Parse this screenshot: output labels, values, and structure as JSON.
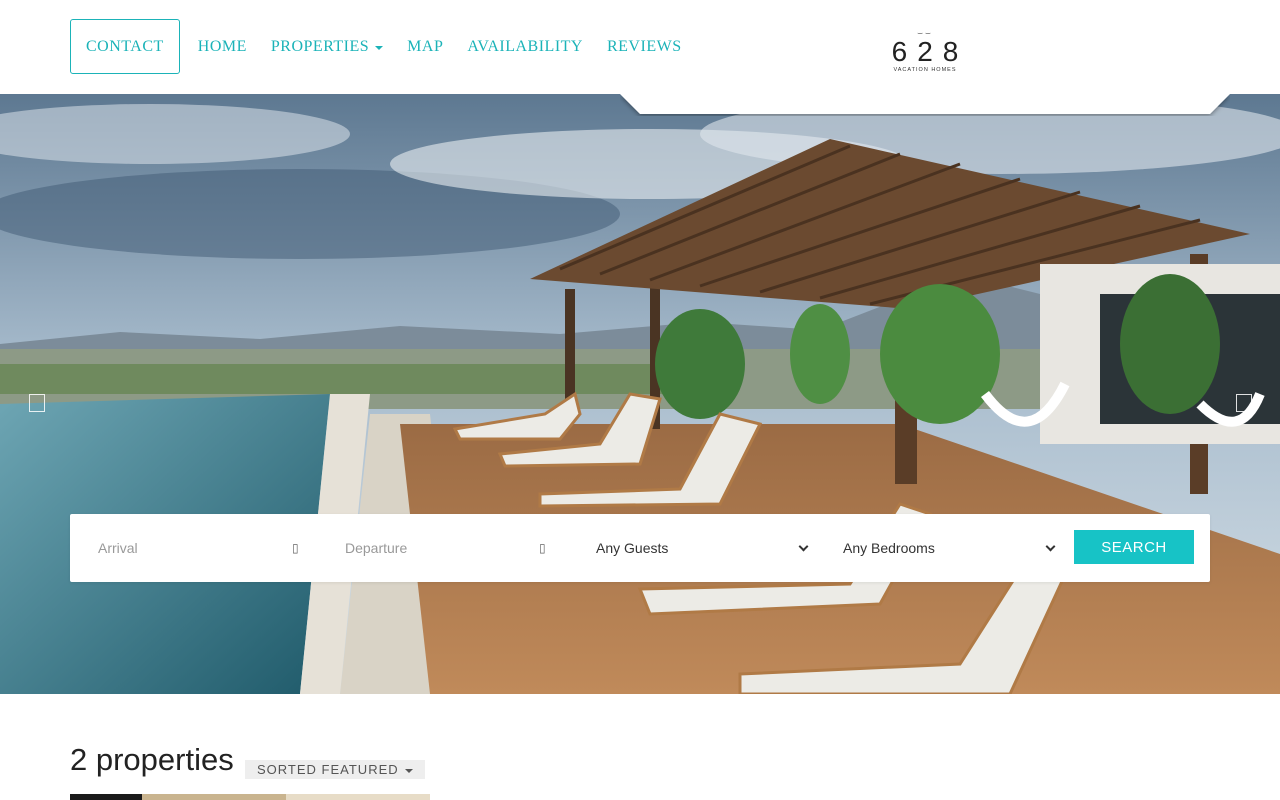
{
  "nav": {
    "contact": "CONTACT",
    "home": "HOME",
    "properties": "PROPERTIES",
    "map": "MAP",
    "availability": "AVAILABILITY",
    "reviews": "REVIEWS"
  },
  "logo": {
    "number": "628",
    "tagline": "VACATION HOMES"
  },
  "search": {
    "arrival_placeholder": "Arrival",
    "departure_placeholder": "Departure",
    "guests_selected": "Any Guests",
    "bedrooms_selected": "Any Bedrooms",
    "button_label": "SEARCH"
  },
  "results": {
    "count_label": "2 properties",
    "sort_label": "SORTED FEATURED"
  },
  "colors": {
    "accent": "#1bb3b8",
    "button": "#17c3c6"
  }
}
